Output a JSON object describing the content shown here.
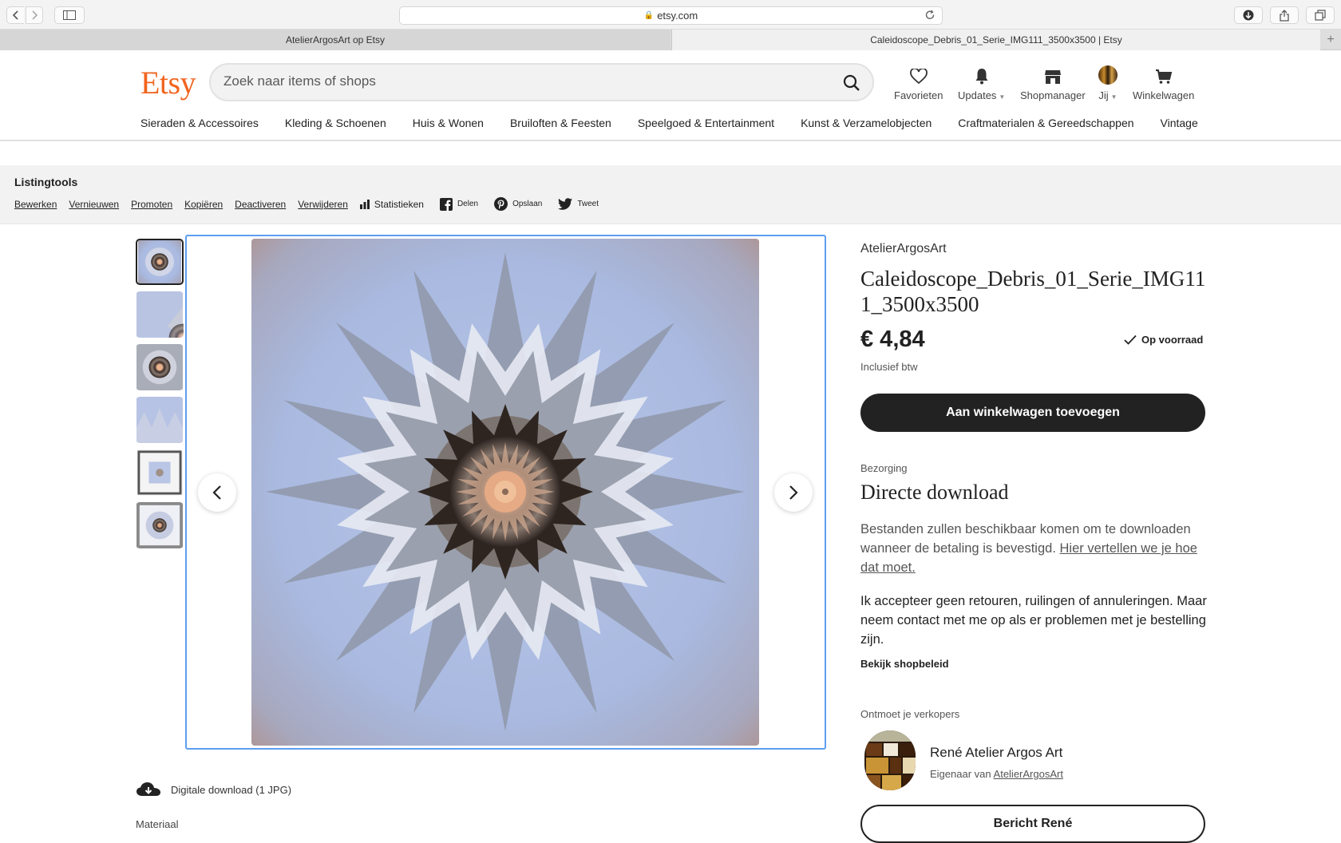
{
  "browser": {
    "url": "etsy.com",
    "tabs": [
      {
        "label": "AtelierArgosArt op Etsy",
        "active": false
      },
      {
        "label": "Caleidoscope_Debris_01_Serie_IMG111_3500x3500 | Etsy",
        "active": true
      }
    ]
  },
  "header": {
    "logo": "Etsy",
    "search_placeholder": "Zoek naar items of shops",
    "nav": {
      "favorites": "Favorieten",
      "updates": "Updates",
      "shopmanager": "Shopmanager",
      "you": "Jij",
      "cart": "Winkelwagen"
    },
    "categories": [
      "Sieraden & Accessoires",
      "Kleding & Schoenen",
      "Huis & Wonen",
      "Bruiloften & Feesten",
      "Speelgoed & Entertainment",
      "Kunst & Verzamelobjecten",
      "Craftmaterialen & Gereedschappen",
      "Vintage"
    ]
  },
  "listing_tools": {
    "title": "Listingtools",
    "links": [
      "Bewerken",
      "Vernieuwen",
      "Promoten",
      "Kopiëren",
      "Deactiveren",
      "Verwijderen"
    ],
    "stats": "Statistieken",
    "share": "Delen",
    "save": "Opslaan",
    "tweet": "Tweet"
  },
  "gallery": {
    "thumbnail_count": 6,
    "selected_index": 0
  },
  "product": {
    "shop": "AtelierArgosArt",
    "title": "Caleidoscope_Debris_01_Serie_IMG111_3500x3500",
    "price": "€ 4,84",
    "stock": "Op voorraad",
    "vat": "Inclusief btw",
    "add_to_cart": "Aan winkelwagen toevoegen",
    "delivery_label": "Bezorging",
    "delivery_title": "Directe download",
    "delivery_text": "Bestanden zullen beschikbaar komen om te downloaden wanneer de betaling is bevestigd.",
    "delivery_link": "Hier vertellen we je hoe dat moet.",
    "policy_text": "Ik accepteer geen retouren, ruilingen of annuleringen. Maar neem contact met me op als er problemen met je bestelling zijn.",
    "policy_link": "Bekijk shopbeleid",
    "download_info": "Digitale download (1 JPG)",
    "material_label": "Materiaal"
  },
  "seller": {
    "meet_label": "Ontmoet je verkopers",
    "name": "René Atelier Argos Art",
    "owner_prefix": "Eigenaar van",
    "owner_shop": "AtelierArgosArt",
    "message_button": "Bericht René"
  },
  "colors": {
    "etsy_orange": "#f1641e",
    "focus_blue": "#5d9ef0",
    "button_dark": "#222222"
  }
}
